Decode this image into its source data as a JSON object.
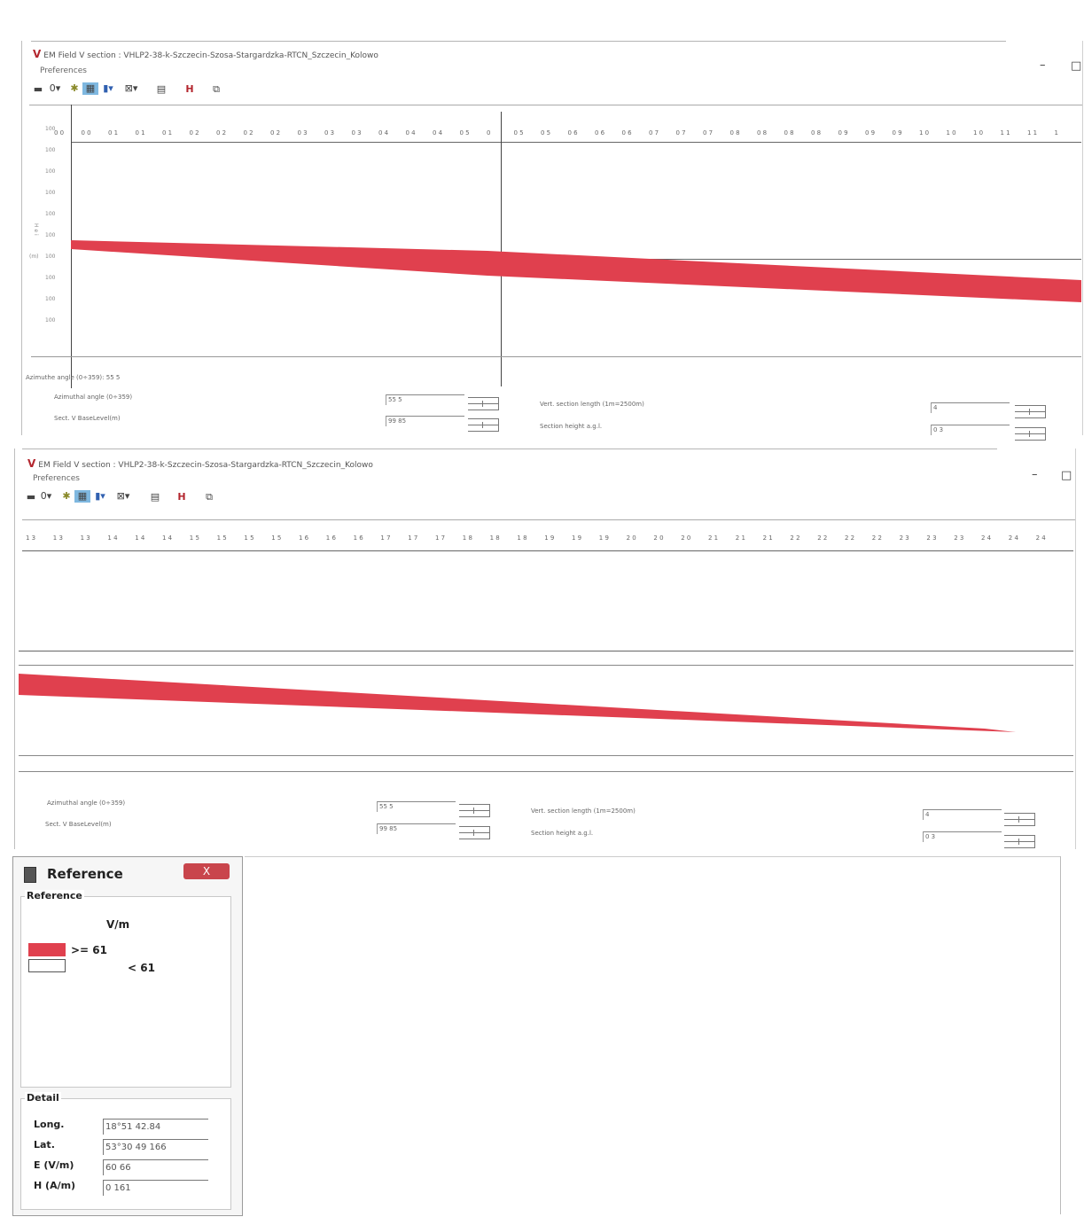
{
  "windows": [
    {
      "title": "EM Field V section : VHLP2-38-k-Szczecin-Szosa-Stargardzka-RTCN_Szczecin_Kolowo",
      "menu": "Preferences",
      "minimize": "–",
      "maximize": "□",
      "ticks": [
        "0 0",
        "0 0",
        "0 1",
        "0 1",
        "0 1",
        "0 2",
        "0 2",
        "0 2",
        "0 2",
        "0 3",
        "0 3",
        "0 3",
        "0 4",
        "0 4",
        "0 4",
        "0 5",
        "0",
        "0 5",
        "0 5",
        "0 6",
        "0 6",
        "0 6",
        "0 7",
        "0 7",
        "0 7",
        "0 8",
        "0 8",
        "0 8",
        "0 8",
        "0 9",
        "0 9",
        "0 9",
        "1 0",
        "1 0",
        "1 0",
        "1 1",
        "1 1",
        "1"
      ],
      "ylabels": [
        "100",
        "100",
        "100",
        "100",
        "100",
        "100",
        "100",
        "100",
        "100",
        "100"
      ],
      "axis_units": "(m)",
      "azimuth_readout": "Azimuthe angle (0÷359): 55 5",
      "fields": {
        "azimuthal_label": "Azimuthal angle (0÷359)",
        "azimuthal_value": "55 5",
        "base_label": "Sect. V BaseLevel(m)",
        "base_value": "99 85",
        "vert_label": "Vert. section length (1m=2500m)",
        "vert_value": "4",
        "height_label": "Section height a.g.l.",
        "height_value": "0 3"
      }
    },
    {
      "title": "EM Field V section : VHLP2-38-k-Szczecin-Szosa-Stargardzka-RTCN_Szczecin_Kolowo",
      "menu": "Preferences",
      "minimize": "–",
      "maximize": "□",
      "ticks": [
        "1 3",
        "1 3",
        "1 3",
        "1 4",
        "1 4",
        "1 4",
        "1 5",
        "1 5",
        "1 5",
        "1 5",
        "1 6",
        "1 6",
        "1 6",
        "1 7",
        "1 7",
        "1 7",
        "1 8",
        "1 8",
        "1 8",
        "1 9",
        "1 9",
        "1 9",
        "2 0",
        "2 0",
        "2 0",
        "2 1",
        "2 1",
        "2 1",
        "2 2",
        "2 2",
        "2 2",
        "2 2",
        "2 3",
        "2 3",
        "2 3",
        "2 4",
        "2 4",
        "2 4"
      ],
      "fields": {
        "azimuthal_label": "Azimuthal angle (0÷359)",
        "azimuthal_value": "55 5",
        "base_label": "Sect. V BaseLevel(m)",
        "base_value": "99 85",
        "vert_label": "Vert. section length (1m=2500m)",
        "vert_value": "4",
        "height_label": "Section height a.g.l.",
        "height_value": "0 3"
      }
    }
  ],
  "reference": {
    "title": "Reference",
    "close": "X",
    "group_label": "Reference",
    "unit": "V/m",
    "legend": [
      {
        "label": ">= 61",
        "color": "#e0404e"
      },
      {
        "label": "< 61",
        "color": "#ffffff"
      }
    ],
    "detail_label": "Detail",
    "details": [
      {
        "label": "Long.",
        "value": "18°51 42.84"
      },
      {
        "label": "Lat.",
        "value": "53°30 49 166"
      },
      {
        "label": "E (V/m)",
        "value": "60 66"
      },
      {
        "label": "H (A/m)",
        "value": "0 161"
      }
    ]
  },
  "colors": {
    "band": "#e0404e"
  }
}
